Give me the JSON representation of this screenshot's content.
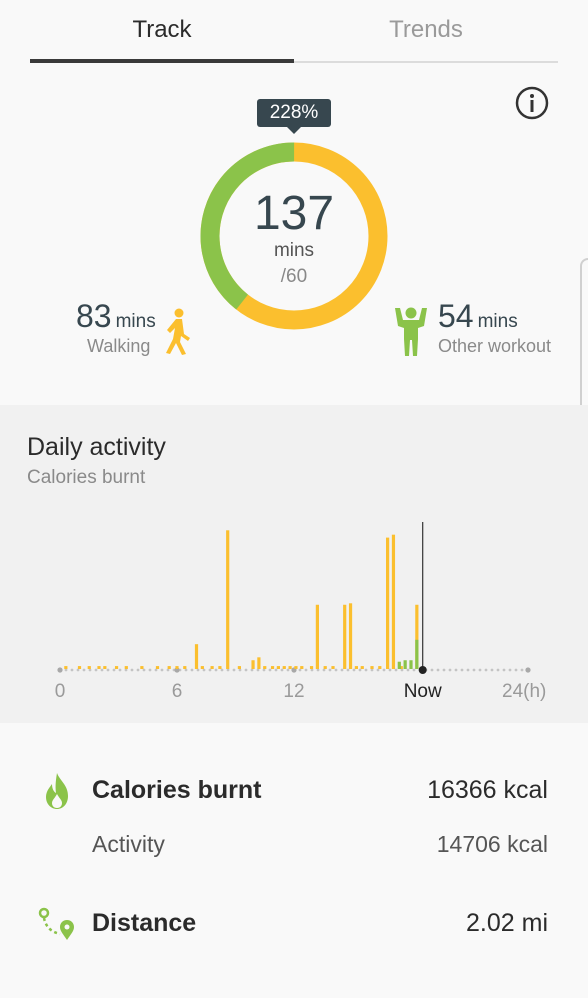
{
  "tabs": {
    "track": "Track",
    "trends": "Trends"
  },
  "summary": {
    "percent": "228%",
    "total": "137",
    "unit": "mins",
    "goal": "/60",
    "walking_fraction": 0.606,
    "walking": {
      "value": "83",
      "unit": "mins",
      "label": "Walking"
    },
    "other": {
      "value": "54",
      "unit": "mins",
      "label": "Other workout"
    }
  },
  "colors": {
    "walking": "#fbbf2e",
    "workout": "#8bc34a",
    "badge": "#37474f"
  },
  "daily": {
    "title": "Daily activity",
    "subtitle": "Calories burnt"
  },
  "chart_data": {
    "type": "bar",
    "xlim": [
      0,
      24
    ],
    "x_ticks": [
      "0",
      "6",
      "12",
      "Now",
      "24(h)"
    ],
    "x_tick_values": [
      0,
      6,
      12,
      18.6,
      24
    ],
    "now_hour": 18.6,
    "series": [
      {
        "color": "#fbbf2e",
        "x": [
          0.3,
          1.0,
          1.5,
          2.0,
          2.3,
          2.9,
          3.4,
          4.2,
          5.0,
          5.6,
          6.0,
          6.4,
          7.0,
          7.3,
          7.8,
          8.2,
          8.6,
          9.2,
          9.9,
          10.2,
          10.5,
          10.9,
          11.2,
          11.5,
          11.8,
          12.1,
          12.4,
          12.9,
          13.2,
          13.6,
          14.0,
          14.6,
          14.9,
          15.2,
          15.5,
          16.0,
          16.4,
          16.8,
          17.1,
          17.5,
          18.3
        ],
        "values": [
          2,
          2,
          2,
          2,
          2,
          2,
          2,
          2,
          2,
          2,
          2,
          2,
          17,
          2,
          2,
          2,
          95,
          2,
          6,
          8,
          2,
          2,
          2,
          2,
          2,
          2,
          2,
          2,
          44,
          2,
          2,
          44,
          45,
          2,
          2,
          2,
          2,
          90,
          92,
          2,
          44
        ]
      },
      {
        "color": "#8bc34a",
        "x": [
          17.4,
          17.7,
          18.0,
          18.3
        ],
        "values": [
          5,
          6,
          6,
          20
        ]
      }
    ]
  },
  "details": {
    "calories_label": "Calories burnt",
    "calories_value": "16366 kcal",
    "activity_label": "Activity",
    "activity_value": "14706 kcal",
    "distance_label": "Distance",
    "distance_value": "2.02 mi"
  }
}
